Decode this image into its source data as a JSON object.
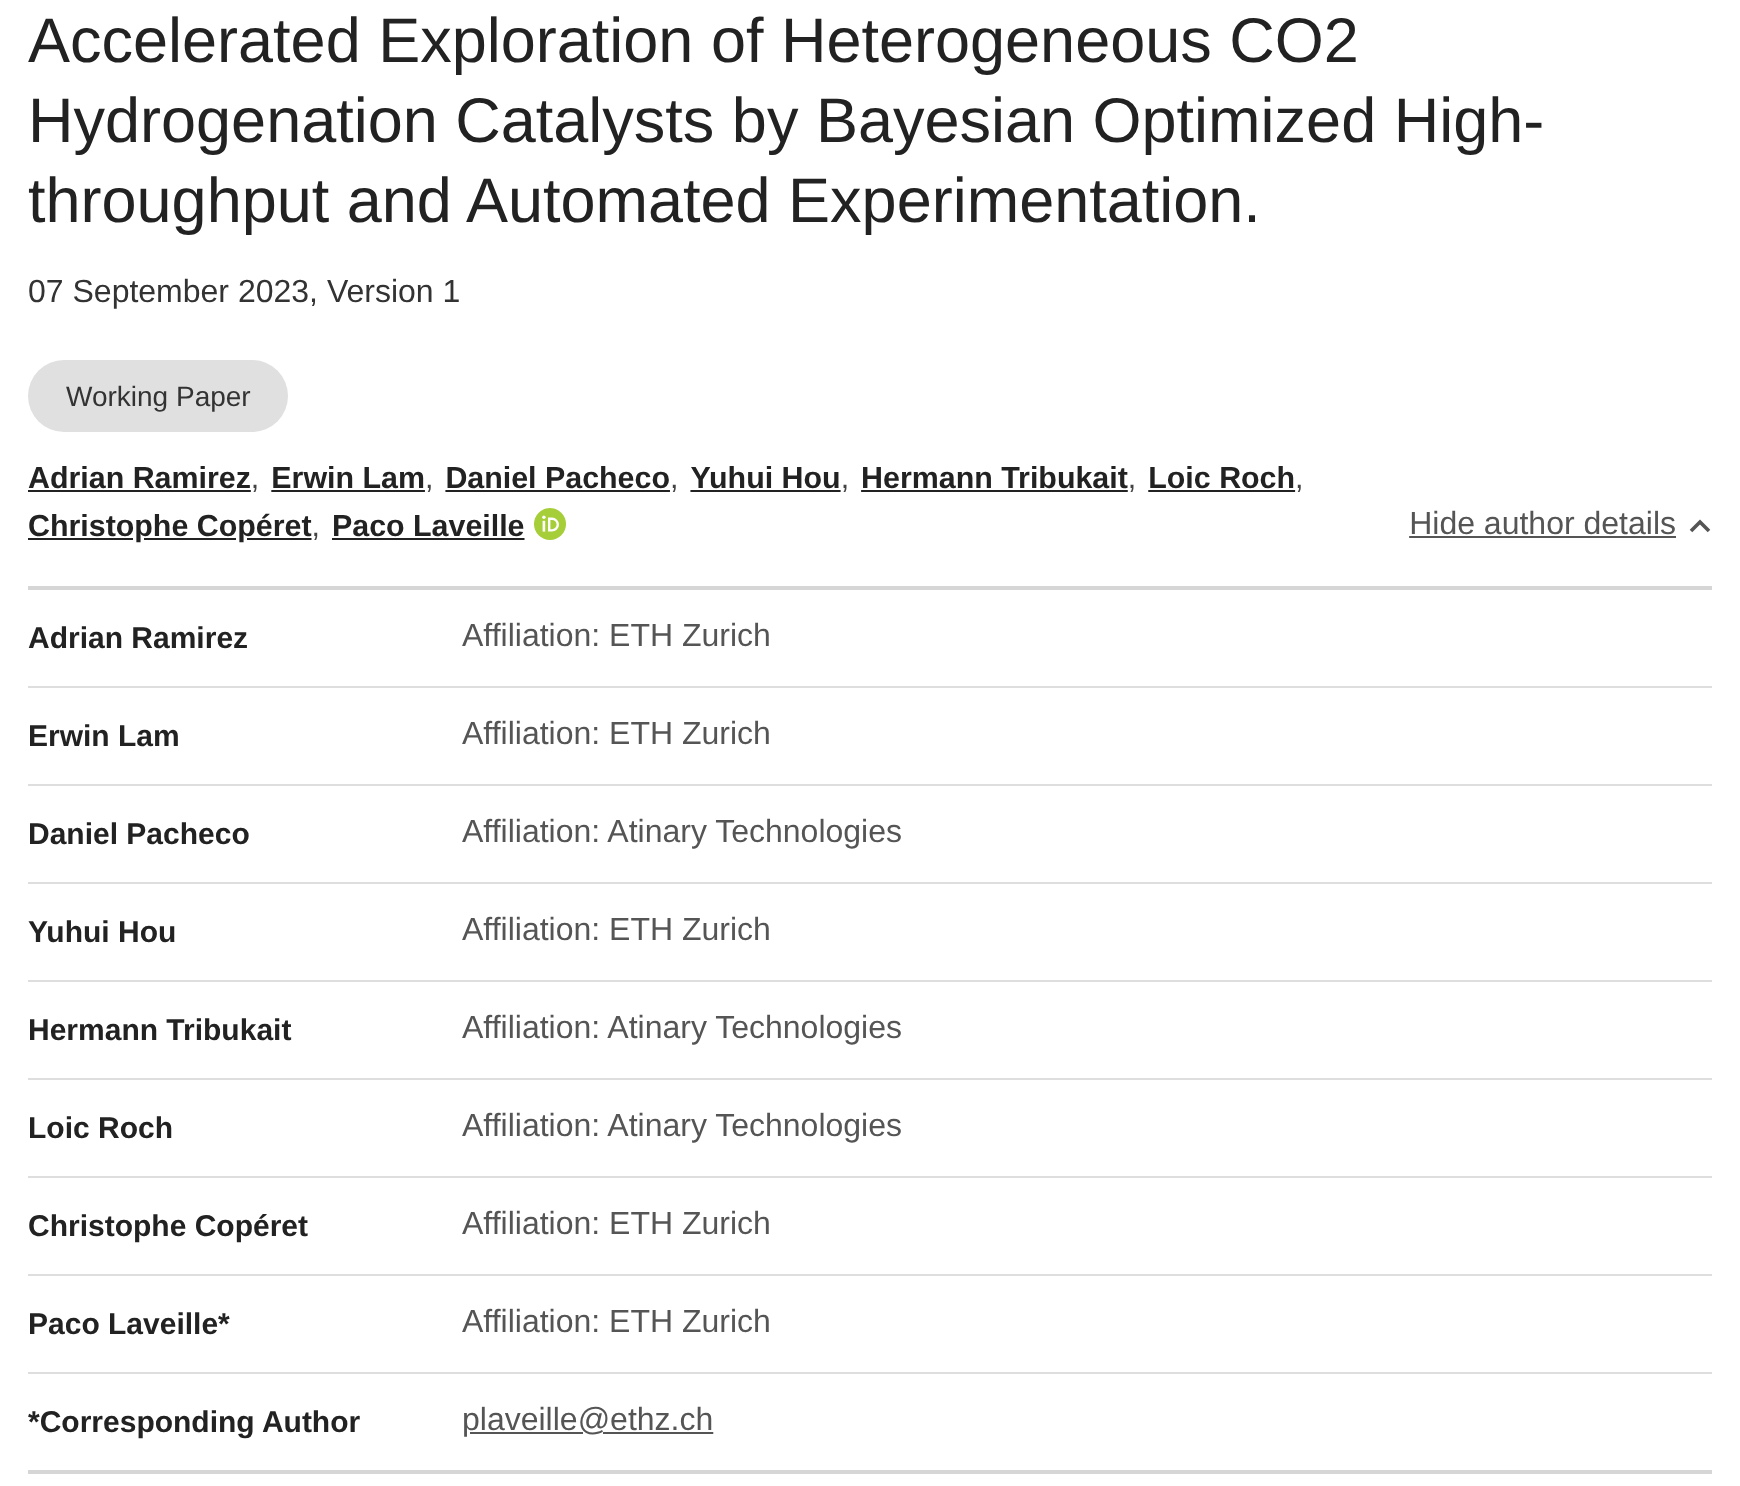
{
  "title": "Accelerated Exploration of Heterogeneous CO2 Hydrogenation Catalysts by Bayesian Optimized High-throughput and Automated Experimentation.",
  "date_version": "07 September 2023, Version 1",
  "tag": "Working Paper",
  "authors": [
    {
      "name": "Adrian Ramirez",
      "separator": ",",
      "orcid": false
    },
    {
      "name": "Erwin Lam",
      "separator": ",",
      "orcid": false
    },
    {
      "name": "Daniel Pacheco",
      "separator": ",",
      "orcid": false
    },
    {
      "name": "Yuhui Hou",
      "separator": ",",
      "orcid": false
    },
    {
      "name": "Hermann Tribukait",
      "separator": ",",
      "orcid": false
    },
    {
      "name": "Loic Roch",
      "separator": ",",
      "orcid": false
    },
    {
      "name": "Christophe Copéret",
      "separator": ",",
      "orcid": false
    },
    {
      "name": "Paco Laveille",
      "orcid": true
    }
  ],
  "author_toggle": {
    "label": "Hide author details",
    "expanded": true
  },
  "details": [
    {
      "kind": "author",
      "name": "Adrian Ramirez",
      "value": "Affiliation: ETH Zurich"
    },
    {
      "kind": "author",
      "name": "Erwin Lam",
      "value": "Affiliation: ETH Zurich"
    },
    {
      "kind": "author",
      "name": "Daniel Pacheco",
      "value": "Affiliation: Atinary Technologies"
    },
    {
      "kind": "author",
      "name": "Yuhui Hou",
      "value": "Affiliation: ETH Zurich"
    },
    {
      "kind": "author",
      "name": "Hermann Tribukait",
      "value": "Affiliation: Atinary Technologies"
    },
    {
      "kind": "author",
      "name": "Loic Roch",
      "value": "Affiliation: Atinary Technologies"
    },
    {
      "kind": "author",
      "name": "Christophe Copéret",
      "value": "Affiliation: ETH Zurich"
    },
    {
      "kind": "author",
      "name": "Paco Laveille*",
      "value": "Affiliation: ETH Zurich"
    },
    {
      "kind": "contact",
      "name": "*Corresponding Author",
      "value": "plaveille@ethz.ch"
    }
  ]
}
